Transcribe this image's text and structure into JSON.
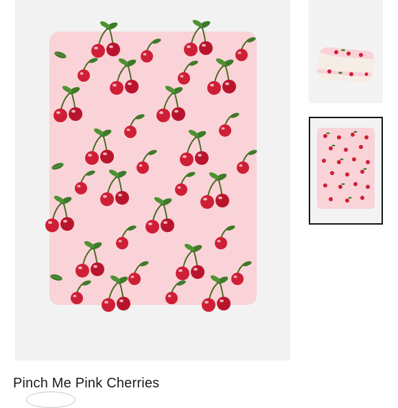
{
  "product": {
    "name": "Pinch Me Pink Cherries"
  },
  "colors": {
    "blanket_pink": "#f9d3d8",
    "cherry_red": "#cf1f36",
    "leaf_green": "#3f7a2a",
    "panel_bg": "#f2f2f2"
  },
  "gallery": {
    "main_image": "cherry-blanket-flat",
    "thumbnails": [
      {
        "image": "cherry-blanket-folded",
        "selected": false
      },
      {
        "image": "cherry-blanket-flat",
        "selected": true
      }
    ]
  }
}
